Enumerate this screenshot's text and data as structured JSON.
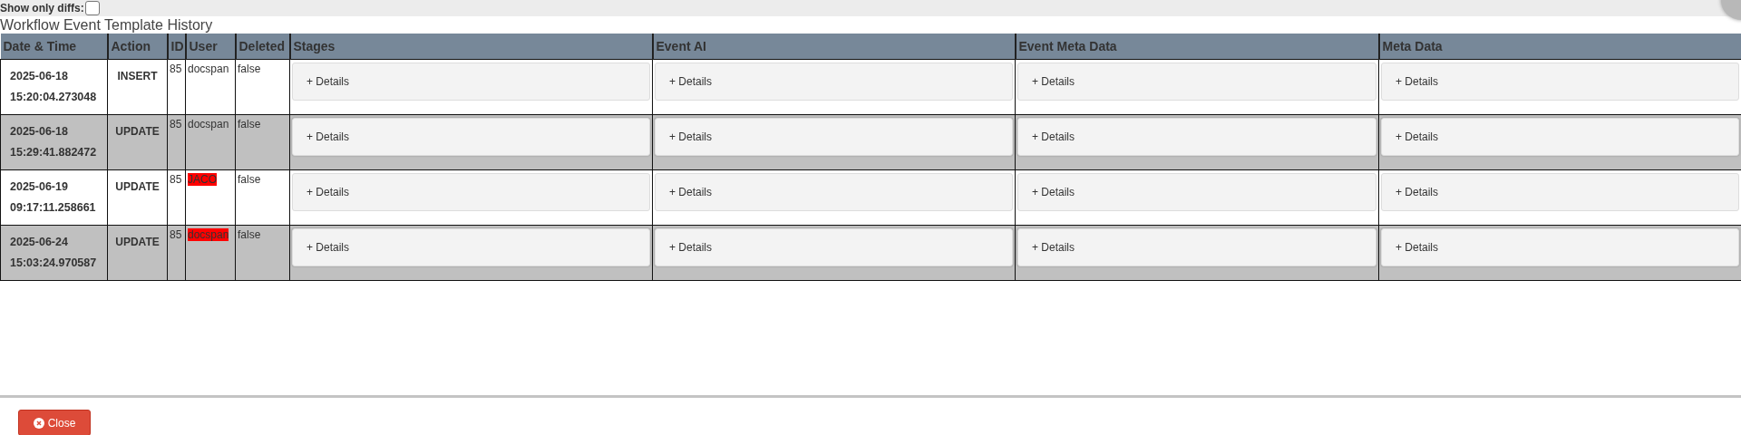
{
  "filter": {
    "label": "Show only diffs:",
    "checked": false
  },
  "title": "Workflow Event Template History",
  "table": {
    "columns": [
      "Date & Time",
      "Action",
      "ID",
      "User",
      "Deleted",
      "Stages",
      "Event AI",
      "Event Meta Data",
      "Meta Data"
    ],
    "rows": [
      {
        "date": "2025-06-18",
        "time": "15:20:04.273048",
        "action": "INSERT",
        "id": "85",
        "user": "docspan",
        "user_changed": false,
        "deleted": "false",
        "shaded": false,
        "details": [
          "+ Details",
          "+ Details",
          "+ Details",
          "+ Details"
        ]
      },
      {
        "date": "2025-06-18",
        "time": "15:29:41.882472",
        "action": "UPDATE",
        "id": "85",
        "user": "docspan",
        "user_changed": false,
        "deleted": "false",
        "shaded": true,
        "details": [
          "+ Details",
          "+ Details",
          "+ Details",
          "+ Details"
        ]
      },
      {
        "date": "2025-06-19",
        "time": "09:17:11.258661",
        "action": "UPDATE",
        "id": "85",
        "user": "JACO",
        "user_changed": true,
        "deleted": "false",
        "shaded": false,
        "details": [
          "+ Details",
          "+ Details",
          "+ Details",
          "+ Details"
        ]
      },
      {
        "date": "2025-06-24",
        "time": "15:03:24.970587",
        "action": "UPDATE",
        "id": "85",
        "user": "docspan",
        "user_changed": true,
        "deleted": "false",
        "shaded": true,
        "details": [
          "+ Details",
          "+ Details",
          "+ Details",
          "+ Details"
        ]
      }
    ]
  },
  "close_button": "Close"
}
